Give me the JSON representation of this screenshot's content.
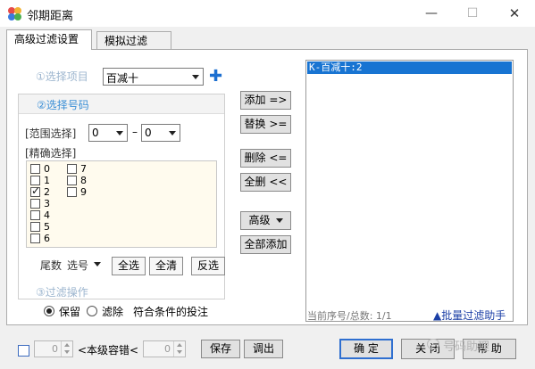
{
  "window": {
    "title": "邻期距离",
    "min_glyph": "—",
    "max_glyph": "☐",
    "close_glyph": "✕"
  },
  "tabs": [
    {
      "label": "高级过滤设置",
      "active": true
    },
    {
      "label": "模拟过滤",
      "active": false
    }
  ],
  "step1": {
    "label": "①选择项目",
    "selected": "百减十",
    "add_icon": "plus-icon",
    "add_glyph": "✚"
  },
  "step2": {
    "label": "②选择号码",
    "range_label": "[范围选择]",
    "range_from": "0",
    "range_sep": "–",
    "range_to": "0",
    "precise_label": "[精确选择]",
    "numbers_col1": [
      {
        "text": "0",
        "checked": false
      },
      {
        "text": "1",
        "checked": false
      },
      {
        "text": "2",
        "checked": true
      },
      {
        "text": "3",
        "checked": false
      },
      {
        "text": "4",
        "checked": false
      },
      {
        "text": "5",
        "checked": false
      },
      {
        "text": "6",
        "checked": false
      }
    ],
    "numbers_col2": [
      {
        "text": "7",
        "checked": false
      },
      {
        "text": "8",
        "checked": false
      },
      {
        "text": "9",
        "checked": false
      }
    ],
    "tail_label": "尾数",
    "pick_label": "选号",
    "select_all": "全选",
    "clear_all": "全清",
    "invert": "反选"
  },
  "actions": {
    "add": "添加 =>",
    "replace": "替换 >=",
    "delete": "删除 <=",
    "delete_all": "全删 <<",
    "advanced": "高级",
    "add_all": "全部添加"
  },
  "result": {
    "items": [
      "K-百减十:2"
    ],
    "status": "当前序号/总数: 1/1",
    "helper": "▲批量过滤助手"
  },
  "step3": {
    "label": "③过滤操作",
    "keep": "保留",
    "drop": "滤除",
    "keep_selected": true,
    "suffix": "符合条件的投注"
  },
  "footer": {
    "tolerance_min": "0",
    "tolerance_label": "<本级容错<",
    "tolerance_max": "0",
    "save": "保存",
    "load": "调出",
    "ok": "确 定",
    "close": "关 闭",
    "help": "帮 助"
  },
  "watermark": "号码助理",
  "colors": {
    "accent": "#1874d2",
    "step": "#3b8fd6",
    "list_bg": "#fffbee"
  }
}
